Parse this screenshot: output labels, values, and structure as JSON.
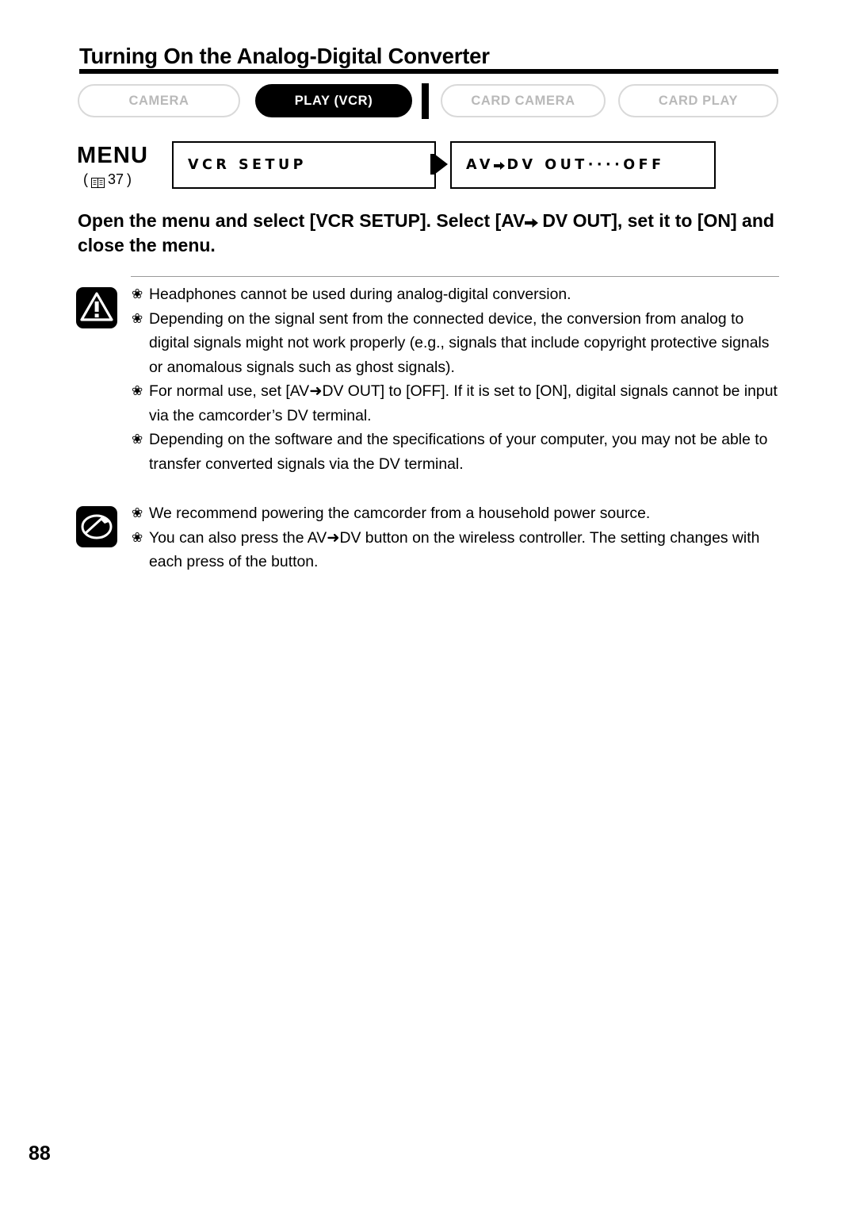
{
  "page": {
    "title": "Turning On the Analog-Digital Converter",
    "number": "88"
  },
  "tabs": [
    {
      "label": "CAMERA",
      "active": false
    },
    {
      "label": "PLAY (VCR)",
      "active": true
    },
    {
      "label": "CARD CAMERA",
      "active": false
    },
    {
      "label": "CARD PLAY",
      "active": false
    }
  ],
  "menu": {
    "label": "MENU",
    "reference": "37",
    "reference_open": "(",
    "reference_close": ")",
    "book_icon": "book-icon",
    "left_item": "VCR SETUP",
    "right_item_prefix": "AV",
    "right_item_suffix": "DV OUT····OFF",
    "arrow_icon": "right-arrow-icon"
  },
  "instruction": {
    "part1": "Open the menu and select [VCR SETUP]. Select [AV",
    "part2": "DV OUT], set it to [ON] and close the menu."
  },
  "notes": {
    "caution_icon": "caution-exclamation-icon",
    "info_icon": "note-pencil-icon",
    "caution_items": [
      "Headphones cannot be used during analog-digital conversion.",
      "Depending on the signal sent from the connected device, the conversion from analog to digital signals might not work properly (e.g., signals that include copyright protective signals or anomalous signals such as ghost signals).",
      "For normal use, set [AV➜DV OUT] to [OFF]. If it is set to [ON], digital signals cannot be input via the camcorder’s DV terminal.",
      "Depending on the software and the specifications of your computer, you may not be able to transfer converted signals via the DV terminal."
    ],
    "info_items": [
      "We recommend powering the camcorder from a household power source.",
      "You can also press the AV➜DV button on the wireless controller. The setting changes with each press of the button."
    ],
    "bullet_glyph": "❀"
  }
}
